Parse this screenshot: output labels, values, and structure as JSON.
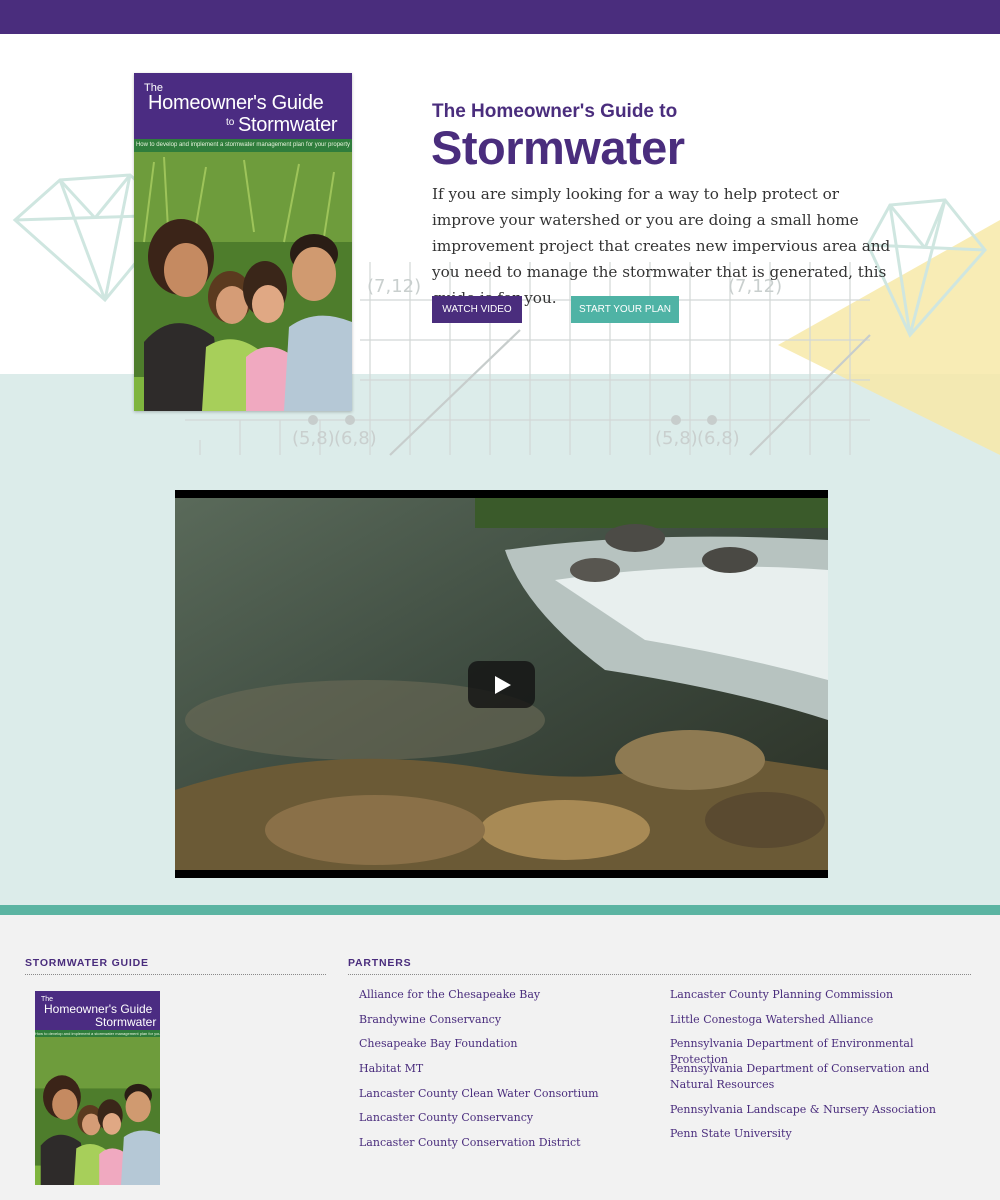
{
  "hero": {
    "book": {
      "the": "The",
      "title": "Homeowner's Guide",
      "to": "to",
      "subject": "Stormwater",
      "strip": "How to develop and implement a stormwater management plan for your property"
    },
    "eyebrow": "The Homeowner's Guide to",
    "headline": "Stormwater",
    "intro": "If you are simply looking for a way to help protect or improve your watershed or you are doing a small home improvement project that creates new impervious area and you need to manage the stormwater that is generated, this guide is for you.",
    "buttons": {
      "watch": "WATCH VIDEO",
      "plan": "START YOUR PLAN"
    },
    "graph_labels": [
      "(7,12)",
      "(7,12)",
      "(5,8)",
      "(6,8)",
      "(5,8)",
      "(6,8)"
    ]
  },
  "footer": {
    "guide_heading": "STORMWATER GUIDE",
    "partners_heading": "PARTNERS",
    "partners_col1": [
      "Alliance for the Chesapeake Bay",
      "Brandywine Conservancy",
      "Chesapeake Bay Foundation",
      "Habitat MT",
      "Lancaster County Clean Water Consortium",
      "Lancaster County Conservancy",
      "Lancaster County Conservation District"
    ],
    "partners_col2": [
      "Lancaster County Planning Commission",
      "Little Conestoga Watershed Alliance",
      "Pennsylvania Department of Environmental Protection",
      "Pennsylvania Department of Conservation and Natural Resources",
      "Pennsylvania Landscape & Nursery Association",
      "Penn State University"
    ]
  },
  "colors": {
    "brand_purple": "#4a2d7d",
    "accent_teal": "#4fb3a5",
    "band_teal": "#dcecea",
    "footer_gray": "#f2f2f2"
  }
}
